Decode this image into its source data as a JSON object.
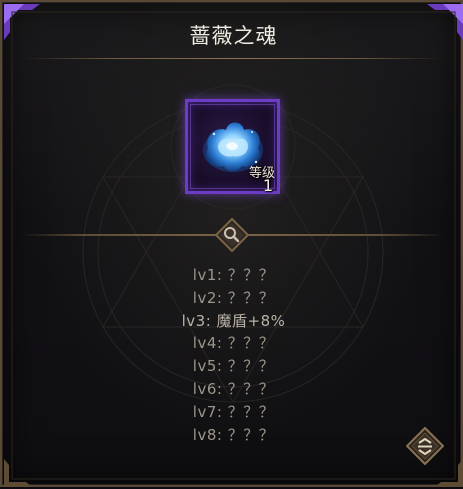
{
  "window": {
    "title": "蔷薇之魂"
  },
  "item": {
    "icon": "blue-rose-icon",
    "level_label": "等级",
    "level_value": "1",
    "rarity_color": "#6c3cc4"
  },
  "buttons": {
    "magnify_icon": "magnifier-icon",
    "expand_icon": "expand-toggle-icon"
  },
  "stats": [
    {
      "label": "lv1: ？？？",
      "known": false
    },
    {
      "label": "lv2: ？？？",
      "known": false
    },
    {
      "label": "lv3: 魔盾+8%",
      "known": true
    },
    {
      "label": "lv4: ？？？",
      "known": false
    },
    {
      "label": "lv5: ？？？",
      "known": false
    },
    {
      "label": "lv6: ？？？",
      "known": false
    },
    {
      "label": "lv7: ？？？",
      "known": false
    },
    {
      "label": "lv8: ？？？",
      "known": false
    }
  ],
  "colors": {
    "accent_purple": "#6c3cc4",
    "frame_gold": "#8a7352",
    "text_light": "#f1ece2",
    "text_dim": "#9c958a"
  }
}
